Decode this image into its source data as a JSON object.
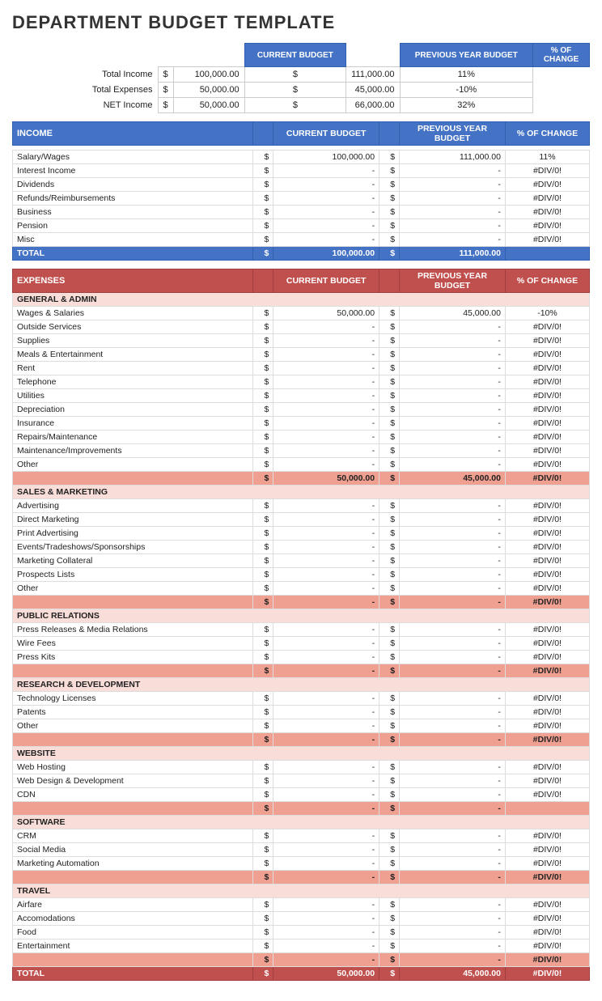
{
  "title": "DEPARTMENT BUDGET TEMPLATE",
  "summary": {
    "headers": [
      "CURRENT BUDGET",
      "PREVIOUS YEAR BUDGET",
      "% OF CHANGE"
    ],
    "rows": [
      {
        "label": "Total Income",
        "curr_sign": "$",
        "curr_val": "100,000.00",
        "prev_sign": "$",
        "prev_val": "111,000.00",
        "pct": "11%"
      },
      {
        "label": "Total Expenses",
        "curr_sign": "$",
        "curr_val": "50,000.00",
        "prev_sign": "$",
        "prev_val": "45,000.00",
        "pct": "-10%"
      },
      {
        "label": "NET Income",
        "curr_sign": "$",
        "curr_val": "50,000.00",
        "prev_sign": "$",
        "prev_val": "66,000.00",
        "pct": "32%"
      }
    ]
  },
  "income_section": {
    "title": "INCOME",
    "headers": [
      "CURRENT BUDGET",
      "PREVIOUS YEAR BUDGET",
      "% OF CHANGE"
    ],
    "rows": [
      {
        "label": "Salary/Wages",
        "curr_val": "100,000.00",
        "prev_val": "111,000.00",
        "pct": "11%"
      },
      {
        "label": "Interest Income",
        "curr_val": "-",
        "prev_val": "-",
        "pct": "#DIV/0!"
      },
      {
        "label": "Dividends",
        "curr_val": "-",
        "prev_val": "-",
        "pct": "#DIV/0!"
      },
      {
        "label": "Refunds/Reimbursements",
        "curr_val": "-",
        "prev_val": "-",
        "pct": "#DIV/0!"
      },
      {
        "label": "Business",
        "curr_val": "-",
        "prev_val": "-",
        "pct": "#DIV/0!"
      },
      {
        "label": "Pension",
        "curr_val": "-",
        "prev_val": "-",
        "pct": "#DIV/0!"
      },
      {
        "label": "Misc",
        "curr_val": "-",
        "prev_val": "-",
        "pct": "#DIV/0!"
      }
    ],
    "total": {
      "label": "TOTAL",
      "curr_val": "100,000.00",
      "prev_val": "111,000.00",
      "pct": ""
    }
  },
  "expenses_section": {
    "title": "EXPENSES",
    "headers": [
      "CURRENT BUDGET",
      "PREVIOUS YEAR BUDGET",
      "% OF CHANGE"
    ],
    "subsections": [
      {
        "name": "GENERAL & ADMIN",
        "rows": [
          {
            "label": "Wages & Salaries",
            "curr_val": "50,000.00",
            "prev_val": "45,000.00",
            "pct": "-10%"
          },
          {
            "label": "Outside Services",
            "curr_val": "-",
            "prev_val": "-",
            "pct": "#DIV/0!"
          },
          {
            "label": "Supplies",
            "curr_val": "-",
            "prev_val": "-",
            "pct": "#DIV/0!"
          },
          {
            "label": "Meals & Entertainment",
            "curr_val": "-",
            "prev_val": "-",
            "pct": "#DIV/0!"
          },
          {
            "label": "Rent",
            "curr_val": "-",
            "prev_val": "-",
            "pct": "#DIV/0!"
          },
          {
            "label": "Telephone",
            "curr_val": "-",
            "prev_val": "-",
            "pct": "#DIV/0!"
          },
          {
            "label": "Utilities",
            "curr_val": "-",
            "prev_val": "-",
            "pct": "#DIV/0!"
          },
          {
            "label": "Depreciation",
            "curr_val": "-",
            "prev_val": "-",
            "pct": "#DIV/0!"
          },
          {
            "label": "Insurance",
            "curr_val": "-",
            "prev_val": "-",
            "pct": "#DIV/0!"
          },
          {
            "label": "Repairs/Maintenance",
            "curr_val": "-",
            "prev_val": "-",
            "pct": "#DIV/0!"
          },
          {
            "label": "Maintenance/Improvements",
            "curr_val": "-",
            "prev_val": "-",
            "pct": "#DIV/0!"
          },
          {
            "label": "Other",
            "curr_val": "-",
            "prev_val": "-",
            "pct": "#DIV/0!"
          }
        ],
        "subtotal": {
          "curr_val": "50,000.00",
          "prev_val": "45,000.00",
          "pct": "#DIV/0!"
        }
      },
      {
        "name": "SALES & MARKETING",
        "rows": [
          {
            "label": "Advertising",
            "curr_val": "-",
            "prev_val": "-",
            "pct": "#DIV/0!"
          },
          {
            "label": "Direct Marketing",
            "curr_val": "-",
            "prev_val": "-",
            "pct": "#DIV/0!"
          },
          {
            "label": "Print Advertising",
            "curr_val": "-",
            "prev_val": "-",
            "pct": "#DIV/0!"
          },
          {
            "label": "Events/Tradeshows/Sponsorships",
            "curr_val": "-",
            "prev_val": "-",
            "pct": "#DIV/0!"
          },
          {
            "label": "Marketing Collateral",
            "curr_val": "-",
            "prev_val": "-",
            "pct": "#DIV/0!"
          },
          {
            "label": "Prospects Lists",
            "curr_val": "-",
            "prev_val": "-",
            "pct": "#DIV/0!"
          },
          {
            "label": "Other",
            "curr_val": "-",
            "prev_val": "-",
            "pct": "#DIV/0!"
          }
        ],
        "subtotal": {
          "curr_val": "-",
          "prev_val": "-",
          "pct": "#DIV/0!"
        }
      },
      {
        "name": "PUBLIC RELATIONS",
        "rows": [
          {
            "label": "Press Releases & Media Relations",
            "curr_val": "-",
            "prev_val": "-",
            "pct": "#DIV/0!"
          },
          {
            "label": "Wire Fees",
            "curr_val": "-",
            "prev_val": "-",
            "pct": "#DIV/0!"
          },
          {
            "label": "Press Kits",
            "curr_val": "-",
            "prev_val": "-",
            "pct": "#DIV/0!"
          }
        ],
        "subtotal": {
          "curr_val": "-",
          "prev_val": "-",
          "pct": "#DIV/0!"
        }
      },
      {
        "name": "RESEARCH & DEVELOPMENT",
        "rows": [
          {
            "label": "Technology Licenses",
            "curr_val": "-",
            "prev_val": "-",
            "pct": "#DIV/0!"
          },
          {
            "label": "Patents",
            "curr_val": "-",
            "prev_val": "-",
            "pct": "#DIV/0!"
          },
          {
            "label": "Other",
            "curr_val": "-",
            "prev_val": "-",
            "pct": "#DIV/0!"
          }
        ],
        "subtotal": {
          "curr_val": "-",
          "prev_val": "-",
          "pct": "#DIV/0!"
        }
      },
      {
        "name": "WEBSITE",
        "rows": [
          {
            "label": "Web Hosting",
            "curr_val": "-",
            "prev_val": "-",
            "pct": "#DIV/0!"
          },
          {
            "label": "Web Design & Development",
            "curr_val": "-",
            "prev_val": "-",
            "pct": "#DIV/0!"
          },
          {
            "label": "CDN",
            "curr_val": "-",
            "prev_val": "-",
            "pct": "#DIV/0!"
          }
        ],
        "subtotal": {
          "curr_val": "-",
          "prev_val": "-",
          "pct": ""
        }
      },
      {
        "name": "SOFTWARE",
        "rows": [
          {
            "label": "CRM",
            "curr_val": "-",
            "prev_val": "-",
            "pct": "#DIV/0!"
          },
          {
            "label": "Social Media",
            "curr_val": "-",
            "prev_val": "-",
            "pct": "#DIV/0!"
          },
          {
            "label": "Marketing Automation",
            "curr_val": "-",
            "prev_val": "-",
            "pct": "#DIV/0!"
          }
        ],
        "subtotal": {
          "curr_val": "-",
          "prev_val": "-",
          "pct": "#DIV/0!"
        }
      },
      {
        "name": "TRAVEL",
        "rows": [
          {
            "label": "Airfare",
            "curr_val": "-",
            "prev_val": "-",
            "pct": "#DIV/0!"
          },
          {
            "label": "Accomodations",
            "curr_val": "-",
            "prev_val": "-",
            "pct": "#DIV/0!"
          },
          {
            "label": "Food",
            "curr_val": "-",
            "prev_val": "-",
            "pct": "#DIV/0!"
          },
          {
            "label": "Entertainment",
            "curr_val": "-",
            "prev_val": "-",
            "pct": "#DIV/0!"
          }
        ],
        "subtotal": {
          "curr_val": "-",
          "prev_val": "-",
          "pct": "#DIV/0!"
        }
      }
    ],
    "grand_total": {
      "label": "TOTAL",
      "curr_val": "50,000.00",
      "prev_val": "45,000.00",
      "pct": "#DIV/0!"
    }
  }
}
